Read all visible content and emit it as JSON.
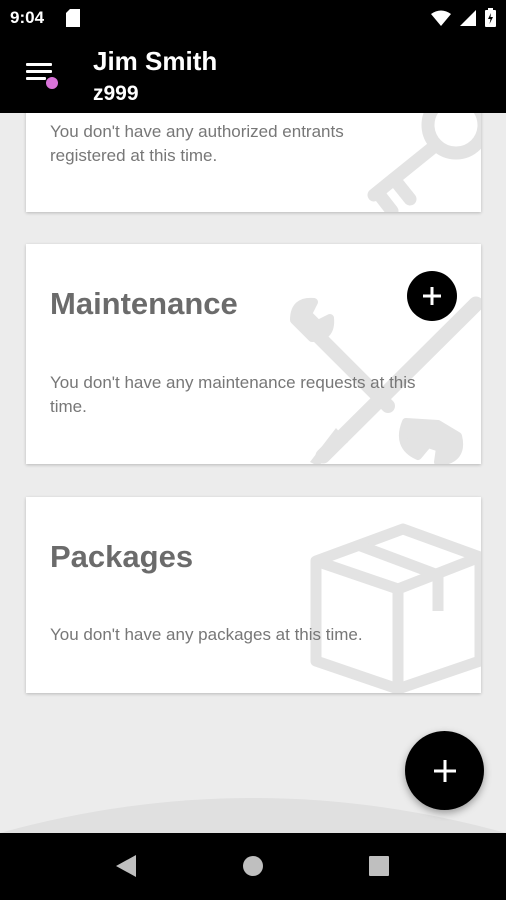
{
  "status_bar": {
    "time": "9:04",
    "icons": [
      "sd-card-icon",
      "wifi-icon",
      "cell-signal-icon",
      "battery-charging-icon"
    ]
  },
  "app_bar": {
    "user_name": "Jim Smith",
    "user_id": "z999",
    "menu_icon": "menu-icon",
    "notification_dot_color": "#d873d8"
  },
  "cards": {
    "entrants": {
      "message": "You don't have any authorized entrants registered at this time.",
      "icon": "key-icon"
    },
    "maintenance": {
      "title": "Maintenance",
      "message": "You don't have any maintenance requests at this time.",
      "icon": "tools-icon",
      "add_icon": "plus-icon"
    },
    "packages": {
      "title": "Packages",
      "message": "You don't have any packages at this time.",
      "icon": "package-icon"
    }
  },
  "fab": {
    "icon": "plus-icon"
  },
  "nav_bar": {
    "icons": [
      "back-icon",
      "home-icon",
      "recents-icon"
    ]
  },
  "colors": {
    "app_bar": "#000000",
    "background": "#ececec",
    "card": "#ffffff",
    "title_text": "#6b6b6b",
    "body_text": "#777777",
    "watermark": "#e3e3e3"
  }
}
